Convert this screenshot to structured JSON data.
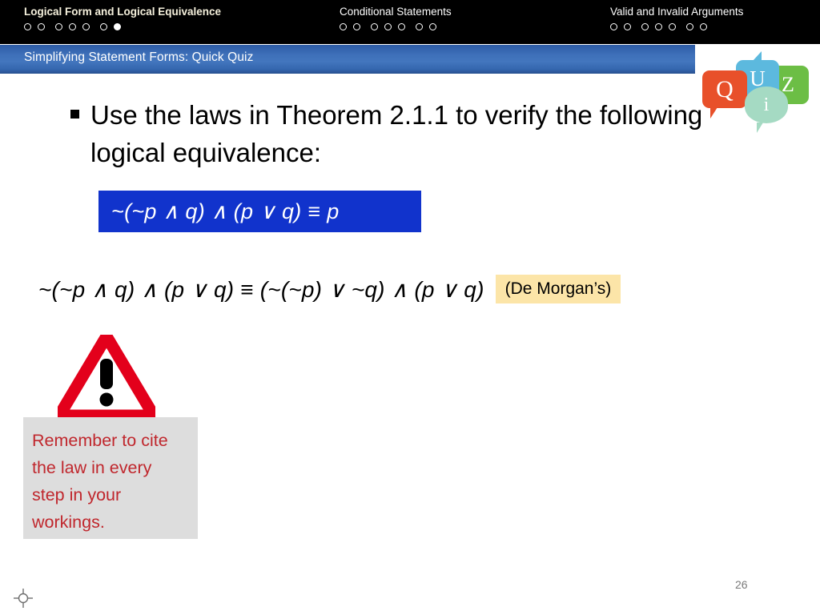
{
  "nav": {
    "sections": [
      {
        "label": "Logical Form and Logical Equivalence",
        "dots_total": 7,
        "dots_filled_index": 6,
        "active": true
      },
      {
        "label": "Conditional Statements",
        "dots_total": 7,
        "dots_filled_index": -1,
        "active": false
      },
      {
        "label": "Valid and Invalid Arguments",
        "dots_total": 7,
        "dots_filled_index": -1,
        "active": false
      }
    ]
  },
  "titlebar": {
    "title": "Simplifying Statement Forms: Quick Quiz",
    "background_start": "#2D5CA6",
    "background_mid": "#4376BE",
    "background_end": "#28508F"
  },
  "quiz_logo": {
    "bubbles": [
      {
        "letter": "Q",
        "color": "#E8502A"
      },
      {
        "letter": "U",
        "color": "#5CB9DE"
      },
      {
        "letter": "Z",
        "color": "#6CBE45"
      },
      {
        "letter": "i",
        "color": "#A5DAC3"
      }
    ]
  },
  "main": {
    "bullet": "Use the laws in Theorem 2.1.1 to verify the following logical equivalence:",
    "highlight_formula": "~(~p ∧ q) ∧ (p ∨ q) ≡ p",
    "highlight_bg": "#1133CC",
    "highlight_fg": "#FFFFFF",
    "working_step": "~(~p ∧ q) ∧ (p ∨ q)  ≡  (~(~p) ∨ ~q) ∧ (p ∨ q)",
    "law_label": "(De Morgan’s)",
    "law_label_bg": "#FCE5A8"
  },
  "reminder": {
    "icon": "warning-triangle-icon",
    "text": "Remember to cite the law in every step in your workings.",
    "text_color": "#C0272D",
    "box_color": "#DDDDDD"
  },
  "footer": {
    "page_number": "26",
    "registration_mark": "registration-crosshair-icon"
  }
}
